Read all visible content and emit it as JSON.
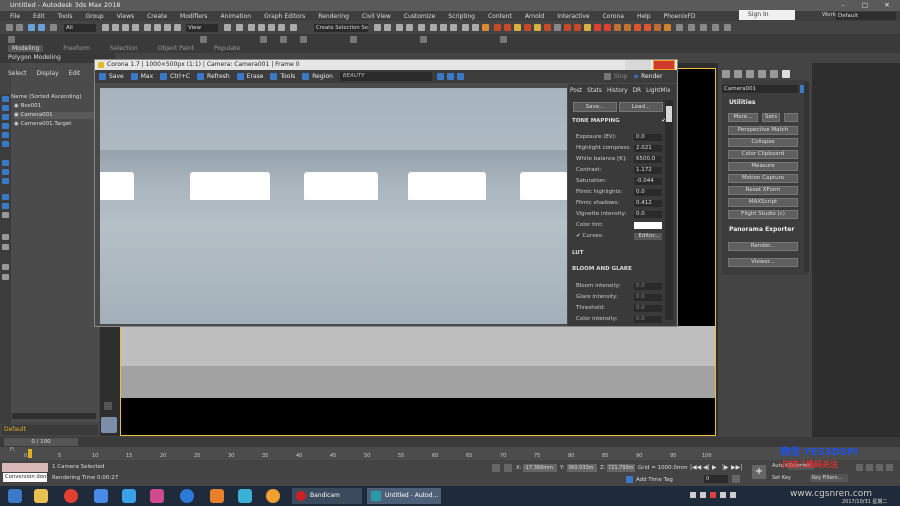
{
  "titlebar": {
    "title": "Untitled - Autodesk 3ds Max 2018",
    "minimize": "–",
    "maximize": "□",
    "close": "✕"
  },
  "menu": [
    "File",
    "Edit",
    "Tools",
    "Group",
    "Views",
    "Create",
    "Modifiers",
    "Animation",
    "Graph Editors",
    "Rendering",
    "Civil View",
    "Customize",
    "Scripting",
    "Content",
    "Arnold",
    "Interactive",
    "Corona",
    "Help",
    "PhoenixFD"
  ],
  "signin": "Sign In",
  "workspace": {
    "label": "Workspaces:",
    "value": "Default"
  },
  "toolbar": {
    "filter": "All",
    "view": "View",
    "selection_set": "Create Selection Set"
  },
  "ribbon": {
    "tabs": [
      "Modeling",
      "Freeform",
      "Selection",
      "Object Paint",
      "Populate"
    ],
    "active": "Modeling"
  },
  "polygon_modeling": "Polygon Modeling",
  "scene_explorer": {
    "menu": [
      "Select",
      "Display",
      "Edit"
    ],
    "header": "Name (Sorted Ascending)",
    "items": [
      "Box001",
      "Camera001",
      "Camera001.Target"
    ],
    "layer": "Default"
  },
  "corona": {
    "title": "Corona 1.7 | 1000×500px (1:1) | Camera: Camera001 | Frame 0",
    "toolbar": [
      "Save",
      "Max",
      "Ctrl+C",
      "Refresh",
      "Erase",
      "Tools",
      "Region"
    ],
    "channel": "BEAUTY",
    "stop": "Stop",
    "render": "Render",
    "tabs": [
      "Post",
      "Stats",
      "History",
      "DR",
      "LightMix"
    ],
    "save_btn": "Save...",
    "load_btn": "Load...",
    "tone_mapping": {
      "title": "TONE MAPPING",
      "rows": [
        {
          "label": "Exposure (EV):",
          "value": "0.0"
        },
        {
          "label": "Highlight compress:",
          "value": "2.021"
        },
        {
          "label": "White balance [K]:",
          "value": "6500.0"
        },
        {
          "label": "Contrast:",
          "value": "1.172"
        },
        {
          "label": "Saturation:",
          "value": "-0.044"
        },
        {
          "label": "Filmic highlights:",
          "value": "0.0"
        },
        {
          "label": "Filmic shadows:",
          "value": "0.412"
        },
        {
          "label": "Vignette intensity:",
          "value": "0.0"
        }
      ],
      "color_tint": "Color tint:",
      "curves": "Curves:",
      "editor": "Editor..."
    },
    "lut": "LUT",
    "bloom": {
      "title": "BLOOM AND GLARE",
      "rows": [
        {
          "label": "Bloom intensity:",
          "value": "0.0"
        },
        {
          "label": "Glare intensity:",
          "value": "0.0"
        },
        {
          "label": "Threshold:",
          "value": "0.0"
        },
        {
          "label": "Color intensity:",
          "value": "0.0"
        }
      ]
    }
  },
  "command_panel": {
    "object_name": "Camera001",
    "utilities_title": "Utilities",
    "more": "More...",
    "sets": "Sets",
    "buttons": [
      "Perspective Match",
      "Collapse",
      "Color Clipboard",
      "Measure",
      "Motion Capture",
      "Reset XForm",
      "MAXScript",
      "Flight Studio (c)"
    ],
    "panorama_title": "Panorama Exporter",
    "render_btn": "Render...",
    "viewer_btn": "Viewer..."
  },
  "timeline": {
    "frame": "0 / 100"
  },
  "ruler": [
    "0",
    "5",
    "10",
    "15",
    "20",
    "25",
    "30",
    "35",
    "40",
    "45",
    "50",
    "55",
    "60",
    "65",
    "70",
    "75",
    "80",
    "85",
    "90",
    "95",
    "100"
  ],
  "status": {
    "selected": "1 Camera Selected",
    "render_time": "Rendering Time  0:00:27",
    "conversion": "Conversion done",
    "x": "-17.366mm",
    "y": "360.033m",
    "z": "721.793m",
    "grid": "Grid = 1000.0mm",
    "add_time_tag": "Add Time Tag",
    "auto_key": "Auto Key",
    "selected_btn": "Selected",
    "set_key": "Set Key",
    "key_filters": "Key Filters..."
  },
  "taskbar": {
    "tasks": [
      "Bandicam",
      "Untitled - Autod..."
    ],
    "clock": "2017/10/31 星期二"
  },
  "watermark": {
    "line1": "微信 YES3DSPI",
    "line2": "扫描二维码关注",
    "line3": "www.cgsnren.com"
  },
  "colors": {
    "accent": "#3a78c8",
    "viewport_border": "#e4c040",
    "close": "#d03a2a"
  }
}
